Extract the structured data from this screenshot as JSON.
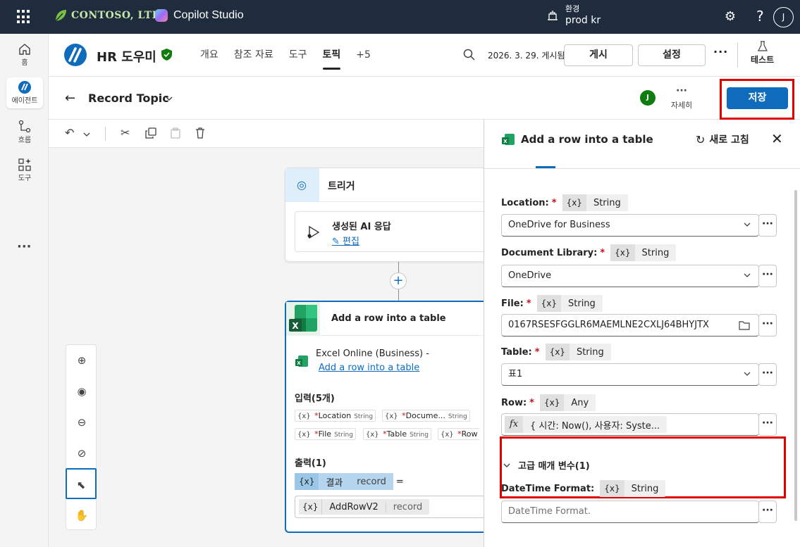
{
  "topbar": {
    "brand": "CONTOSO, LTD.",
    "product": "Copilot Studio",
    "env_label": "환경",
    "env_value": "prod kr",
    "help": "?",
    "avatar": "J"
  },
  "leftrail": {
    "items": [
      {
        "label": "홈",
        "icon": "home-icon"
      },
      {
        "label": "에이전트",
        "icon": "agent-icon"
      },
      {
        "label": "흐름",
        "icon": "flow-icon"
      },
      {
        "label": "도구",
        "icon": "tools-icon"
      }
    ],
    "more": "···"
  },
  "agent": {
    "name": "HR 도우미",
    "tabs": [
      "개요",
      "참조 자료",
      "도구",
      "토픽",
      "+5"
    ],
    "active_tab": "토픽",
    "published": "2026. 3. 29. 게시됨",
    "publish_btn": "게시",
    "settings_btn": "설정",
    "more": "···",
    "test_label": "테스트"
  },
  "topic": {
    "title": "Record Topic",
    "avatar": "J",
    "details_label": "자세히",
    "details_dots": "···",
    "save_btn": "저장"
  },
  "canvas": {
    "trigger_title": "트리거",
    "trigger_item": "생성된 AI 응답",
    "trigger_edit": "편집",
    "action_title": "Add a row into a table",
    "service": "Excel Online (Business)  -",
    "service_link": "Add a row into a table",
    "inputs_header": "입력(5개)",
    "inputs": [
      {
        "name": "Location",
        "type": "String"
      },
      {
        "name": "Docume...",
        "type": "String"
      },
      {
        "name": "File",
        "type": "String"
      },
      {
        "name": "Table",
        "type": "String"
      },
      {
        "name": "Row",
        "type": ""
      }
    ],
    "outputs_header": "출력(1)",
    "output_name": "결과",
    "output_type": "record",
    "output_var": "AddRowV2",
    "output_var_type": "record",
    "var_symbol": "{x}",
    "eq": "="
  },
  "panel": {
    "title": "Add a row into a table",
    "refresh": "새로 고침",
    "fields": [
      {
        "label": "Location:",
        "required": "*",
        "type": "String",
        "value": "OneDrive for Business"
      },
      {
        "label": "Document Library:",
        "required": "*",
        "type": "String",
        "value": "OneDrive"
      },
      {
        "label": "File:",
        "required": "*",
        "type": "String",
        "value": "0167RSESFGGLR6MAEMLNE2CXLJ64BHYJTX"
      },
      {
        "label": "Table:",
        "required": "*",
        "type": "String",
        "value": "표1"
      },
      {
        "label": "Row:",
        "required": "*",
        "type": "Any",
        "value": "{ 시간: Now(), 사용자: Syste..."
      }
    ],
    "advanced": "고급 매개 변수(1)",
    "datetime_label": "DateTime Format:",
    "datetime_type": "String",
    "datetime_placeholder": "DateTime Format.",
    "var_symbol": "{x}",
    "fx": "fx",
    "dots": "···"
  }
}
